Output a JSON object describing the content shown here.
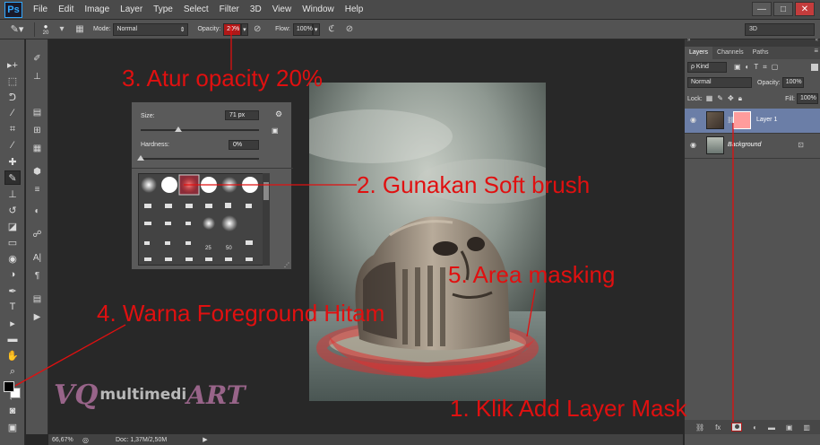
{
  "app": {
    "logo": "Ps",
    "menu": [
      "File",
      "Edit",
      "Image",
      "Layer",
      "Type",
      "Select",
      "Filter",
      "3D",
      "View",
      "Window",
      "Help"
    ],
    "window_controls": [
      "—",
      "□",
      "✕"
    ]
  },
  "options_bar": {
    "brush_size": "20",
    "mode_label": "Mode:",
    "mode_value": "Normal",
    "opacity_label": "Opacity:",
    "opacity_value": "20%",
    "flow_label": "Flow:",
    "flow_value": "100%",
    "workspace": "3D"
  },
  "brush_picker": {
    "size_label": "Size:",
    "size_value": "71 px",
    "size_fraction": 0.32,
    "hardness_label": "Hardness:",
    "hardness_value": "0%",
    "hardness_fraction": 0.0,
    "preset_labels": [
      "25",
      "50"
    ]
  },
  "layers_panel": {
    "tabs": [
      "Layers",
      "Channels",
      "Paths"
    ],
    "filter_label": "ρ Kind",
    "blend_mode": "Normal",
    "opacity_label": "Opacity:",
    "opacity_value": "100%",
    "lock_label": "Lock:",
    "fill_label": "Fill:",
    "fill_value": "100%",
    "layers": [
      {
        "name": "Layer 1",
        "selected": true,
        "has_mask": true
      },
      {
        "name": "Background",
        "selected": false,
        "locked": true
      }
    ],
    "footer_icons": [
      "link-icon",
      "fx-icon",
      "add-mask-icon",
      "adjustment-icon",
      "folder-icon",
      "new-layer-icon",
      "trash-icon"
    ]
  },
  "status_bar": {
    "zoom": "66,67%",
    "doc_info": "Doc: 1,37M/2,50M"
  },
  "annotations": {
    "step3": "3. Atur opacity 20%",
    "step2": "2. Gunakan Soft brush",
    "step5": "5. Area masking",
    "step4": "4. Warna Foreground Hitam",
    "step1": "1. Klik Add Layer Mask"
  },
  "watermark": {
    "vq": "VQ",
    "multimedia": "multimedi",
    "art": "ART"
  },
  "colors": {
    "annotation_red": "#e01010",
    "mask_overlay": "#e03030",
    "selected_layer": "#6b7ea7",
    "mask_thumb": "#ff9c9c",
    "foreground": "#000000",
    "background": "#ffffff"
  }
}
